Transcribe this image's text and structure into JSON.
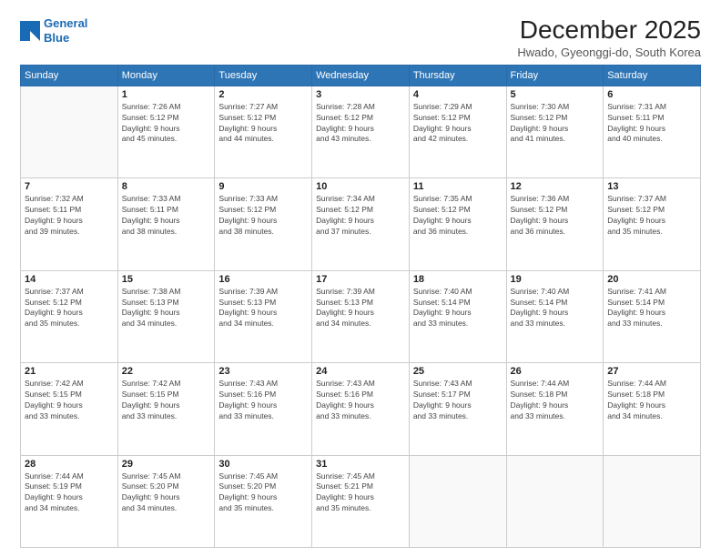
{
  "logo": {
    "line1": "General",
    "line2": "Blue"
  },
  "title": "December 2025",
  "subtitle": "Hwado, Gyeonggi-do, South Korea",
  "weekdays": [
    "Sunday",
    "Monday",
    "Tuesday",
    "Wednesday",
    "Thursday",
    "Friday",
    "Saturday"
  ],
  "weeks": [
    [
      {
        "day": "",
        "info": ""
      },
      {
        "day": "1",
        "info": "Sunrise: 7:26 AM\nSunset: 5:12 PM\nDaylight: 9 hours\nand 45 minutes."
      },
      {
        "day": "2",
        "info": "Sunrise: 7:27 AM\nSunset: 5:12 PM\nDaylight: 9 hours\nand 44 minutes."
      },
      {
        "day": "3",
        "info": "Sunrise: 7:28 AM\nSunset: 5:12 PM\nDaylight: 9 hours\nand 43 minutes."
      },
      {
        "day": "4",
        "info": "Sunrise: 7:29 AM\nSunset: 5:12 PM\nDaylight: 9 hours\nand 42 minutes."
      },
      {
        "day": "5",
        "info": "Sunrise: 7:30 AM\nSunset: 5:12 PM\nDaylight: 9 hours\nand 41 minutes."
      },
      {
        "day": "6",
        "info": "Sunrise: 7:31 AM\nSunset: 5:11 PM\nDaylight: 9 hours\nand 40 minutes."
      }
    ],
    [
      {
        "day": "7",
        "info": "Sunrise: 7:32 AM\nSunset: 5:11 PM\nDaylight: 9 hours\nand 39 minutes."
      },
      {
        "day": "8",
        "info": "Sunrise: 7:33 AM\nSunset: 5:11 PM\nDaylight: 9 hours\nand 38 minutes."
      },
      {
        "day": "9",
        "info": "Sunrise: 7:33 AM\nSunset: 5:12 PM\nDaylight: 9 hours\nand 38 minutes."
      },
      {
        "day": "10",
        "info": "Sunrise: 7:34 AM\nSunset: 5:12 PM\nDaylight: 9 hours\nand 37 minutes."
      },
      {
        "day": "11",
        "info": "Sunrise: 7:35 AM\nSunset: 5:12 PM\nDaylight: 9 hours\nand 36 minutes."
      },
      {
        "day": "12",
        "info": "Sunrise: 7:36 AM\nSunset: 5:12 PM\nDaylight: 9 hours\nand 36 minutes."
      },
      {
        "day": "13",
        "info": "Sunrise: 7:37 AM\nSunset: 5:12 PM\nDaylight: 9 hours\nand 35 minutes."
      }
    ],
    [
      {
        "day": "14",
        "info": "Sunrise: 7:37 AM\nSunset: 5:12 PM\nDaylight: 9 hours\nand 35 minutes."
      },
      {
        "day": "15",
        "info": "Sunrise: 7:38 AM\nSunset: 5:13 PM\nDaylight: 9 hours\nand 34 minutes."
      },
      {
        "day": "16",
        "info": "Sunrise: 7:39 AM\nSunset: 5:13 PM\nDaylight: 9 hours\nand 34 minutes."
      },
      {
        "day": "17",
        "info": "Sunrise: 7:39 AM\nSunset: 5:13 PM\nDaylight: 9 hours\nand 34 minutes."
      },
      {
        "day": "18",
        "info": "Sunrise: 7:40 AM\nSunset: 5:14 PM\nDaylight: 9 hours\nand 33 minutes."
      },
      {
        "day": "19",
        "info": "Sunrise: 7:40 AM\nSunset: 5:14 PM\nDaylight: 9 hours\nand 33 minutes."
      },
      {
        "day": "20",
        "info": "Sunrise: 7:41 AM\nSunset: 5:14 PM\nDaylight: 9 hours\nand 33 minutes."
      }
    ],
    [
      {
        "day": "21",
        "info": "Sunrise: 7:42 AM\nSunset: 5:15 PM\nDaylight: 9 hours\nand 33 minutes."
      },
      {
        "day": "22",
        "info": "Sunrise: 7:42 AM\nSunset: 5:15 PM\nDaylight: 9 hours\nand 33 minutes."
      },
      {
        "day": "23",
        "info": "Sunrise: 7:43 AM\nSunset: 5:16 PM\nDaylight: 9 hours\nand 33 minutes."
      },
      {
        "day": "24",
        "info": "Sunrise: 7:43 AM\nSunset: 5:16 PM\nDaylight: 9 hours\nand 33 minutes."
      },
      {
        "day": "25",
        "info": "Sunrise: 7:43 AM\nSunset: 5:17 PM\nDaylight: 9 hours\nand 33 minutes."
      },
      {
        "day": "26",
        "info": "Sunrise: 7:44 AM\nSunset: 5:18 PM\nDaylight: 9 hours\nand 33 minutes."
      },
      {
        "day": "27",
        "info": "Sunrise: 7:44 AM\nSunset: 5:18 PM\nDaylight: 9 hours\nand 34 minutes."
      }
    ],
    [
      {
        "day": "28",
        "info": "Sunrise: 7:44 AM\nSunset: 5:19 PM\nDaylight: 9 hours\nand 34 minutes."
      },
      {
        "day": "29",
        "info": "Sunrise: 7:45 AM\nSunset: 5:20 PM\nDaylight: 9 hours\nand 34 minutes."
      },
      {
        "day": "30",
        "info": "Sunrise: 7:45 AM\nSunset: 5:20 PM\nDaylight: 9 hours\nand 35 minutes."
      },
      {
        "day": "31",
        "info": "Sunrise: 7:45 AM\nSunset: 5:21 PM\nDaylight: 9 hours\nand 35 minutes."
      },
      {
        "day": "",
        "info": ""
      },
      {
        "day": "",
        "info": ""
      },
      {
        "day": "",
        "info": ""
      }
    ]
  ]
}
